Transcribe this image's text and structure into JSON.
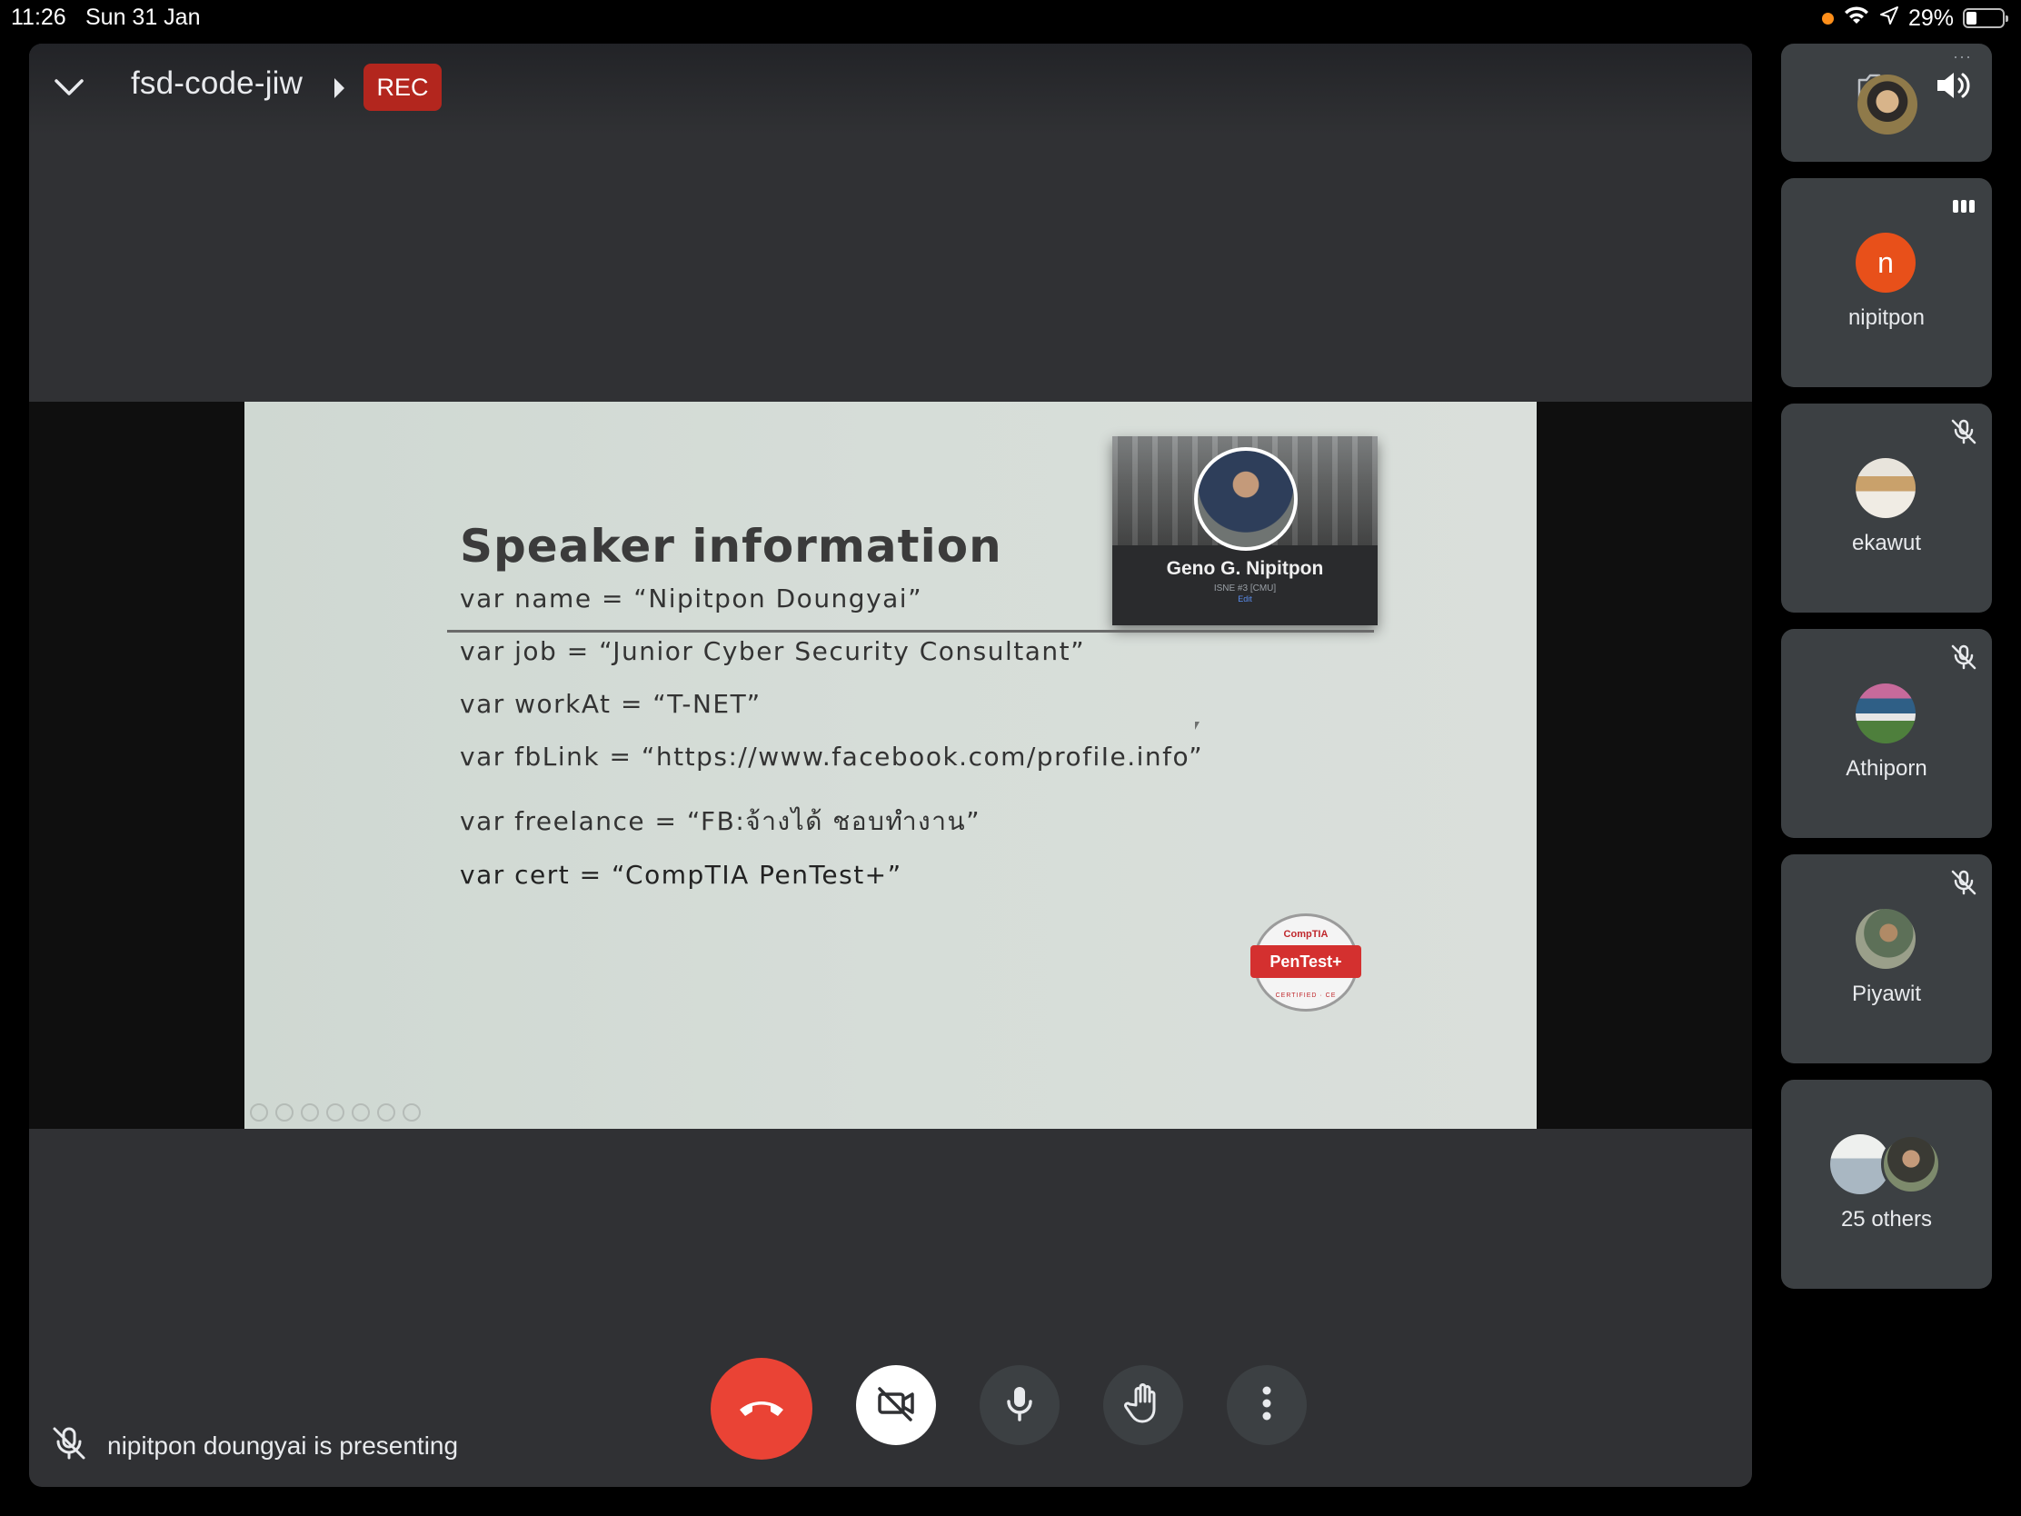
{
  "status_bar": {
    "time": "11:26",
    "date": "Sun 31 Jan",
    "battery": "29%",
    "battery_level": 0.29
  },
  "meeting": {
    "title": "fsd-code-jiw",
    "rec_label": "REC"
  },
  "slide": {
    "title": "Speaker information",
    "lines": [
      "var name = “Nipitpon Doungyai”",
      "var job = “Junior Cyber Security Consultant”",
      "var workAt = “T-NET”",
      "var fbLink = “https://www.facebook.com/profiIe.info”",
      "var freelance = “FB:จ้างได้ ชอบทำงาน”",
      "var cert = “CompTIA PenTest+”"
    ],
    "profile_card": {
      "name": "Geno G. Nipitpon",
      "subtitle": "ISNE #3 [CMU]",
      "edit": "Edit"
    },
    "cert_badge": {
      "top": "CompTIA",
      "main": "PenTest+",
      "bottom": "CERTIFIED · CE"
    }
  },
  "presenting_text": "nipitpon doungyai is presenting",
  "participants": [
    {
      "name": "nipitpon",
      "initial": "n",
      "avatar_color": "#e8501a",
      "state": "speaking"
    },
    {
      "name": "ekawut",
      "state": "muted"
    },
    {
      "name": "Athiporn",
      "state": "muted"
    },
    {
      "name": "Piyawit",
      "state": "muted"
    },
    {
      "name": "25 others"
    }
  ],
  "colors": {
    "stage_bg": "#303134",
    "tile_bg": "#3c4043",
    "end_call": "#ea4335",
    "rec": "#b3261e"
  }
}
